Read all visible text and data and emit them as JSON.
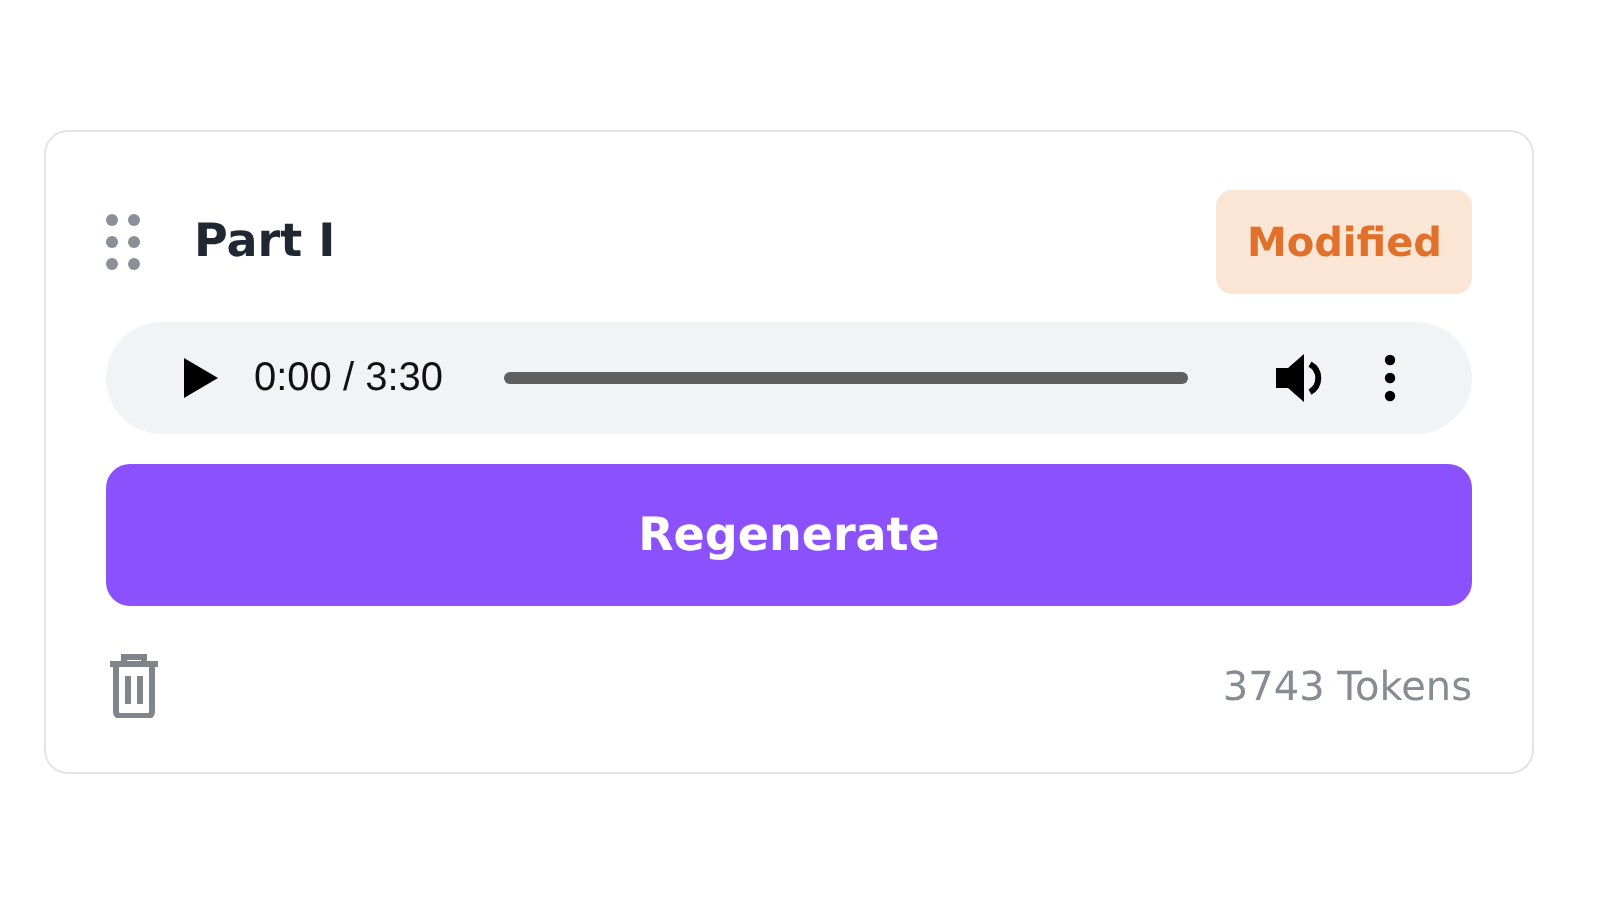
{
  "card": {
    "title": "Part I",
    "badge": "Modified",
    "audio": {
      "time": "0:00 / 3:30"
    },
    "button": "Regenerate",
    "tokens": "3743 Tokens"
  }
}
